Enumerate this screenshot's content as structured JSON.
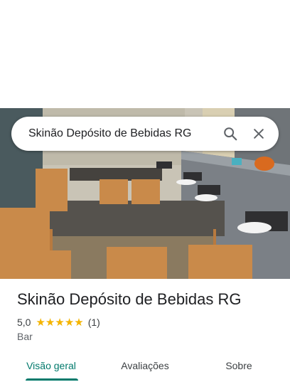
{
  "search": {
    "query": "Skinão Depósito de Bebidas RG",
    "search_icon": "search-icon",
    "close_icon": "close-icon"
  },
  "place": {
    "name": "Skinão Depósito de Bebidas RG",
    "rating": "5,0",
    "stars": 5,
    "reviews_count": "(1)",
    "category": "Bar"
  },
  "tabs": [
    {
      "label": "Visão geral",
      "active": true
    },
    {
      "label": "Avaliações",
      "active": false
    },
    {
      "label": "Sobre",
      "active": false
    }
  ],
  "colors": {
    "accent": "#00796b",
    "star": "#f4b400"
  }
}
